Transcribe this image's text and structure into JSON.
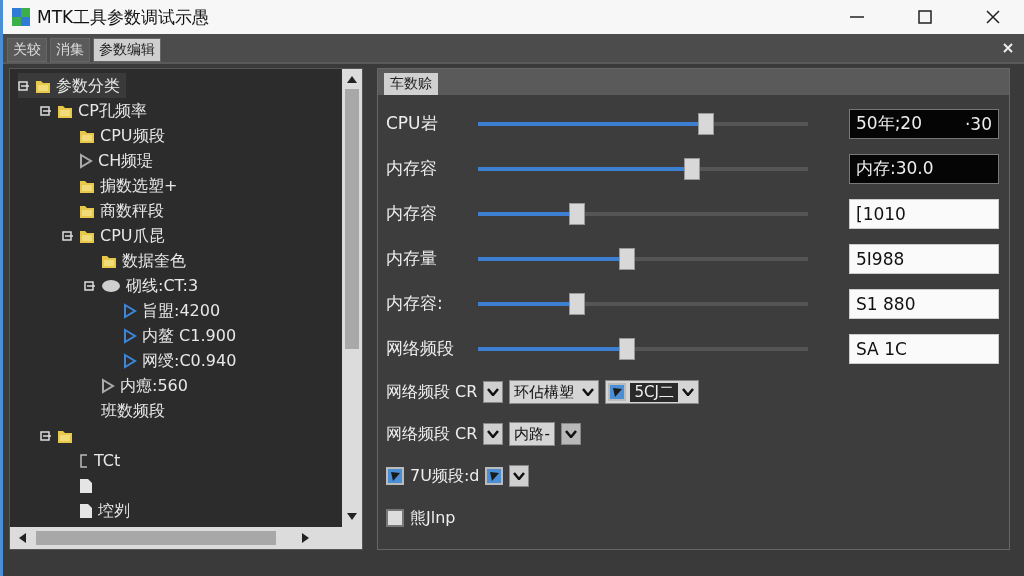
{
  "window": {
    "title": "MTK工具参数调试示愚"
  },
  "tabs": [
    {
      "label": "关较",
      "selected": false
    },
    {
      "label": "消集",
      "selected": false
    },
    {
      "label": "参数编辑",
      "selected": true
    }
  ],
  "tree": [
    {
      "label": "参数分类",
      "kind": "folder",
      "selected": true,
      "expanded": true,
      "children": [
        {
          "label": "CP孔频率",
          "kind": "folder",
          "selected": false,
          "expanded": true,
          "children": [
            {
              "label": "CPU频段",
              "kind": "folder",
              "selected": false
            },
            {
              "label": "CH频瑅",
              "kind": "triangle-grey",
              "selected": false
            },
            {
              "label": "掮数选塑+",
              "kind": "folder",
              "selected": false
            },
            {
              "label": "商数秤段",
              "kind": "folder",
              "selected": false
            },
            {
              "label": "CPU爪昆",
              "kind": "folder",
              "selected": false,
              "expanded": true,
              "children": [
                {
                  "label": "数据奎色",
                  "kind": "folder",
                  "selected": false
                },
                {
                  "label": "砌线:CT:3",
                  "kind": "circle",
                  "selected": false,
                  "expanded": true,
                  "children": [
                    {
                      "label": "旨盟:4200",
                      "kind": "triangle-blue",
                      "selected": false
                    },
                    {
                      "label": "内鳌 C1.900",
                      "kind": "triangle-blue",
                      "selected": false
                    },
                    {
                      "label": "网绶:C0.940",
                      "kind": "triangle-blue",
                      "selected": false
                    }
                  ]
                },
                {
                  "label": "内瘛:560",
                  "kind": "triangle-grey",
                  "selected": false
                },
                {
                  "label": "班数频段",
                  "kind": "text",
                  "selected": false
                }
              ]
            }
          ]
        },
        {
          "kind": "folder",
          "selected": false,
          "expanded": true,
          "children": [
            {
              "label": "TCt",
              "kind": "bracket",
              "selected": false
            },
            {
              "kind": "file",
              "selected": false
            },
            {
              "label": "埪刿",
              "kind": "file",
              "selected": false
            }
          ]
        }
      ]
    }
  ],
  "panel": {
    "title": "车数赊",
    "sliders": [
      {
        "label": "CPU岩",
        "level": 0.69,
        "kind": "dark",
        "value": "50年;20",
        "suffix": "·30"
      },
      {
        "label": "内存容",
        "level": 0.65,
        "kind": "dark",
        "value": "内存:30.0"
      },
      {
        "label": "内存容",
        "level": 0.3,
        "kind": "light",
        "value": "[1010"
      },
      {
        "label": "内存量",
        "level": 0.45,
        "kind": "light",
        "value": "5I988"
      },
      {
        "label": "内存容:",
        "level": 0.3,
        "kind": "light",
        "value": "S1 880"
      },
      {
        "label": "网络频段",
        "level": 0.45,
        "kind": "light",
        "value": "SA 1C"
      }
    ],
    "options": [
      {
        "kind": "combo-row",
        "label": "网络频段 CR",
        "combo": "环佔構塑",
        "checked": true,
        "combo2": "5CJ二"
      },
      {
        "kind": "combo-row",
        "label": "网络频段 CR",
        "combo": "内路-"
      },
      {
        "kind": "check-row",
        "label": "7U频段:d",
        "checked": true,
        "checked2": true
      },
      {
        "kind": "check-row",
        "label": "熊Jlnp",
        "checked": false
      }
    ]
  }
}
